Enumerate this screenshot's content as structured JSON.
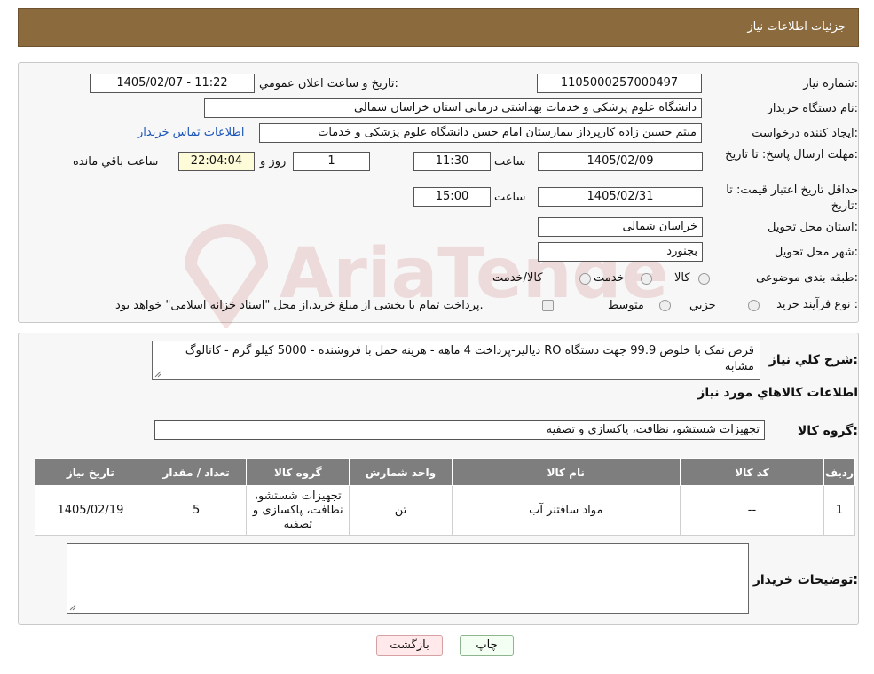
{
  "header": {
    "title": "جزئیات اطلاعات نیاز"
  },
  "form": {
    "need_number_label": "شماره نیاز:",
    "need_number": "1105000257000497",
    "announce_label": "تاریخ و ساعت اعلان عمومي:",
    "announce_value": "1405/02/07 - 11:22",
    "buyer_org_label": "نام دستگاه خريدار:",
    "buyer_org": "دانشگاه علوم پزشکی و خدمات بهداشتی درمانی استان خراسان شمالی",
    "requester_label": "ایجاد کننده درخواست:",
    "requester": "میثم  حسین زاده  کارپرداز بیمارستان امام حسن دانشگاه علوم پزشکی و خدمات",
    "contact_link": "اطلاعات تماس خریدار",
    "deadline_label": "مهلت ارسال پاسخ: تا تاریخ:",
    "deadline_date": "1405/02/09",
    "time_label": "ساعت",
    "deadline_time": "11:30",
    "days": "1",
    "days_label": "روز و",
    "remaining": "22:04:04",
    "remaining_label": "ساعت باقي مانده",
    "validity_label": "حداقل تاریخ اعتبار قیمت: تا تاریخ:",
    "validity_date": "1405/02/31",
    "validity_time": "15:00",
    "province_label": "استان محل تحویل:",
    "province": "خراسان شمالی",
    "city_label": "شهر محل تحویل:",
    "city": "بجنورد",
    "category_label": "طبقه بندی موضوعی:",
    "category_options": [
      "کالا",
      "خدمت",
      "کالا/خدمت"
    ],
    "process_label": "نوع فرآیند خرید :",
    "process_options": [
      "جزيي",
      "متوسط"
    ],
    "process_note": "پرداخت تمام یا بخشی از مبلغ خرید،از محل \"اسناد خزانه اسلامی\" خواهد بود."
  },
  "summary": {
    "description_label": "شرح كلي نياز:",
    "description": "قرص نمک با خلوص 99.9 جهت دستگاه RO دیالیز-پرداخت 4 ماهه - هزینه حمل با فروشنده - 5000 کیلو گرم - کاتالوگ مشابه",
    "goods_info_title": "اطلاعات كالاهاي مورد نياز",
    "goods_group_label": "گروه کالا:",
    "goods_group": "تجهیزات شستشو، نظافت، پاکسازی و تصفیه",
    "table": {
      "headers": [
        "رديف",
        "کد کالا",
        "نام کالا",
        "واحد شمارش",
        "گروه کالا",
        "تعداد / مقدار",
        "تاریخ نیاز"
      ],
      "rows": [
        [
          "1",
          "--",
          "مواد سافتنر آب",
          "تن",
          "تجهیزات شستشو، نظافت، پاکسازی و تصفیه",
          "5",
          "1405/02/19"
        ]
      ]
    },
    "buyer_notes_label": "توضیحات خریدار:",
    "buyer_notes": ""
  },
  "buttons": {
    "print": "چاپ",
    "back": "بازگشت"
  },
  "watermark": {
    "text": "AriaTender.neT",
    "color": "#b73a3a"
  }
}
